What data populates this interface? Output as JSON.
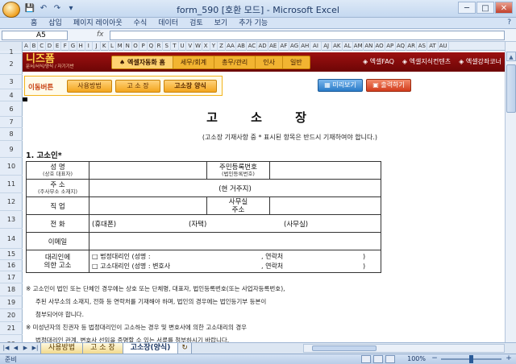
{
  "window": {
    "title": "form_590 [호환 모드] - Microsoft Excel",
    "min": "─",
    "max": "□",
    "close": "✕"
  },
  "qat": [
    "💾",
    "↶",
    "↷",
    "▾"
  ],
  "ribbon": {
    "tabs": [
      "홈",
      "삽입",
      "페이지 레이아웃",
      "수식",
      "데이터",
      "검토",
      "보기",
      "추가 기능"
    ],
    "help": "?"
  },
  "formula_bar": {
    "name_box": "A5",
    "fx_label": "fx",
    "content": ""
  },
  "columns": [
    "A",
    "B",
    "C",
    "D",
    "E",
    "F",
    "G",
    "H",
    "I",
    "J",
    "K",
    "L",
    "M",
    "N",
    "O",
    "P",
    "Q",
    "R",
    "S",
    "T",
    "U",
    "V",
    "W",
    "X",
    "Y",
    "Z",
    "AA",
    "AB",
    "AC",
    "AD",
    "AE",
    "AF",
    "AG",
    "AH",
    "AI",
    "AJ",
    "AK",
    "AL",
    "AM",
    "AN",
    "AO",
    "AP",
    "AQ",
    "AR",
    "AS",
    "AT",
    "AU"
  ],
  "rows": [
    "1",
    "2",
    "3",
    "4",
    "6",
    "7",
    "8",
    "9",
    "10",
    "11",
    "12",
    "13",
    "14",
    "15",
    "16",
    "17",
    "18",
    "19",
    "20",
    "21",
    "22"
  ],
  "banner": {
    "logo": "니즈폼",
    "logo_sub": "문서/서식/양식 / 자기기반",
    "nav": [
      "엑셀자동화 홈",
      "세무/회계",
      "총무/관리",
      "인사",
      "일반"
    ],
    "links": [
      "엑셀FAQ",
      "엑셀지식컨텐츠",
      "엑셀강좌코너"
    ]
  },
  "move": {
    "label": "이동버튼",
    "buttons": [
      "사용방법",
      "고 소 장",
      "고소장 양식"
    ],
    "preview": "미리보기",
    "print": "출력하기"
  },
  "document": {
    "title": "고 소 장",
    "note": "(고소장 기재사항 중 * 표시된 항목은 반드시 기재하여야 합니다.)",
    "section": "1. 고소인*",
    "rows": {
      "name": "성 명",
      "name_sub": "(상호 대표자)",
      "idnum": "주민등록번호",
      "idnum_sub": "(법인등록번호)",
      "address": "주 소",
      "address_sub": "(주사무소 소재지)",
      "current": "(현 거주지)",
      "job": "직 업",
      "office": "사무실",
      "office2": "주소",
      "phone": "전 화",
      "mobile": "(휴대폰)",
      "home": "(자택)",
      "officephone": "(사무실)",
      "email": "이메일",
      "agent": "대리인에",
      "agent2": "의한 고소",
      "legal": "□ 법정대리인 (성명 :",
      "lawyer": "□ 고소대리인 (성명 : 변호사",
      "contact": ", 연락처",
      "close": ")"
    },
    "notes": [
      "※ 고소인이 법인 또는 단체인 경우에는 상호 또는 단체명, 대표자, 법인등록번호(또는 사업자등록번호),",
      "주된 사무소의 소재지, 전화 등 연락처를 기재해야 하며, 법인의 경우에는 법인등기부 등본이",
      "첨부되어야 합니다.",
      "※ 미성년자의 친권자 등 법정대리인이 고소하는 경우 및 변호사에 의한 고소대리의 경우",
      "법정대리인 관계, 변호사 선임을 증명할 수 있는 서류를 첨부하시기 바랍니다."
    ]
  },
  "sheet_tabs": [
    "사용방법",
    "고 소 장",
    "고소장(양식)"
  ],
  "sheet_tab_nav": [
    "|◀",
    "◀",
    "▶",
    "▶|"
  ],
  "new_tab": "↻",
  "status": {
    "ready": "준비",
    "zoom": "100%",
    "zoom_level": 0.5,
    "zoom_out": "−",
    "zoom_in": "+"
  }
}
